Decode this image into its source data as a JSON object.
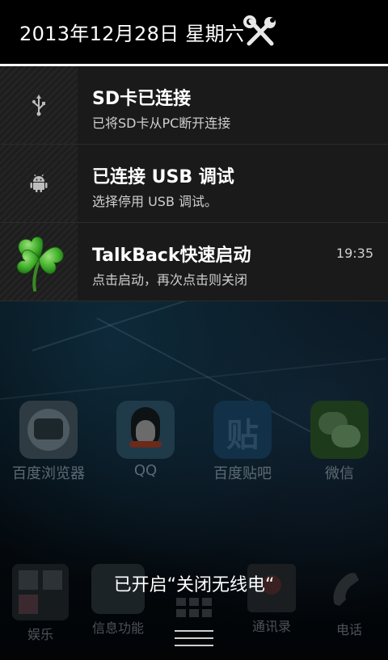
{
  "header": {
    "date": "2013年12月28日 星期六"
  },
  "notifications": [
    {
      "title": "SD卡已连接",
      "subtitle": "已将SD卡从PC断开连接",
      "icon": "usb-icon"
    },
    {
      "title": "已连接 USB 调试",
      "subtitle": "选择停用 USB 调试。",
      "icon": "android-icon"
    },
    {
      "title": "TalkBack快速启动",
      "subtitle": "点击启动，再次点击则关闭",
      "time": "19:35",
      "icon": "clover-icon"
    }
  ],
  "home_apps": [
    {
      "label": "百度浏览器"
    },
    {
      "label": "QQ"
    },
    {
      "label": "百度贴吧",
      "glyph": "贴"
    },
    {
      "label": "微信"
    }
  ],
  "dock": [
    {
      "label": "娱乐"
    },
    {
      "label": "信息功能"
    },
    {
      "label": "通讯录"
    },
    {
      "label": "电话"
    }
  ],
  "toast": "已开启“关闭无线电“",
  "colors": {
    "panel": "#1a1a1a",
    "divider": "#ffffff",
    "clover": "#3fae2a"
  }
}
